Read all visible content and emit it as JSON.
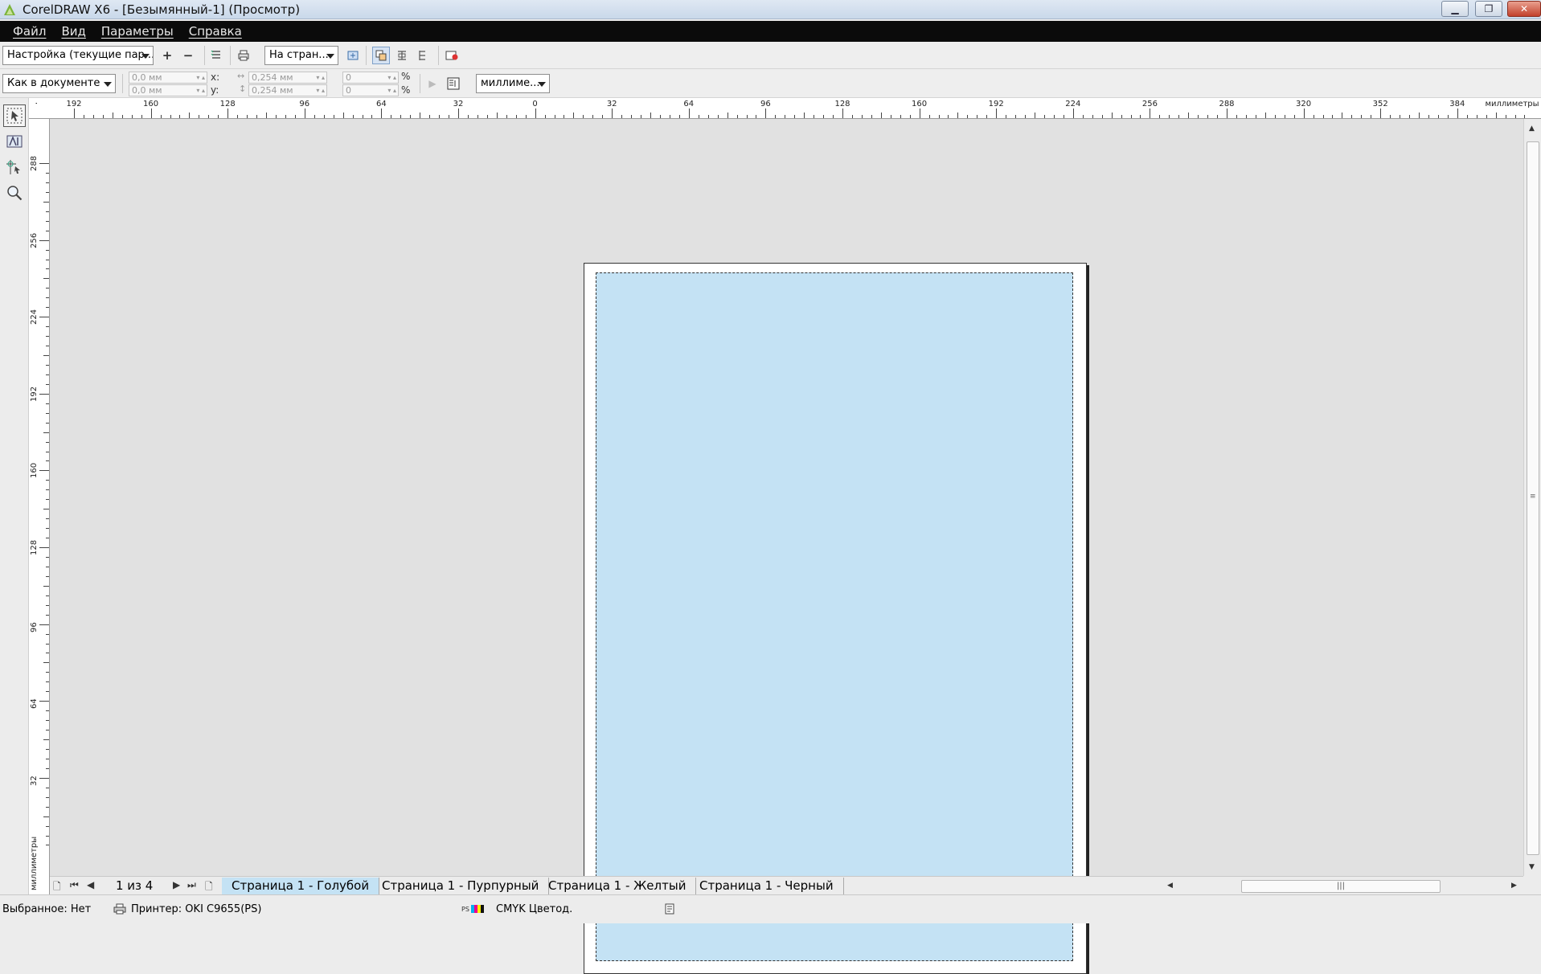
{
  "window": {
    "title": "CorelDRAW X6 - [Безымянный-1] (Просмотр)",
    "min_glyph": "▁",
    "max_glyph": "❐",
    "close_glyph": "✕"
  },
  "menu": {
    "items": [
      {
        "label": "Файл"
      },
      {
        "label": "Вид"
      },
      {
        "label": "Параметры"
      },
      {
        "label": "Справка"
      }
    ]
  },
  "toolbar1": {
    "preset_combo": "Настройка (текущие пар...",
    "add_glyph": "+",
    "remove_glyph": "−",
    "page_fit_combo": "На стран..."
  },
  "toolbar2": {
    "position_combo": "Как в документе",
    "x_value": "0,0 мм",
    "y_value": "0,0 мм",
    "x_label": "x:",
    "y_label": "y:",
    "width_value": "0,254 мм",
    "height_value": "0,254 мм",
    "scale_x": "0",
    "scale_y": "0",
    "percent": "%",
    "units_combo": "миллиме..."
  },
  "ruler": {
    "units_label": "миллиметры",
    "h_labels": [
      "192",
      "160",
      "128",
      "96",
      "64",
      "32",
      "0",
      "32",
      "64",
      "96",
      "128",
      "160",
      "192",
      "224",
      "256",
      "288",
      "320",
      "352",
      "384"
    ],
    "v_labels": [
      "288",
      "256",
      "224",
      "192",
      "160",
      "128",
      "96",
      "64",
      "32"
    ]
  },
  "pagebar": {
    "page_counter": "1 из 4",
    "tabs": [
      {
        "label": "Страница 1 - Голубой"
      },
      {
        "label": "Страница 1 - Пурпурный"
      },
      {
        "label": "Страница 1 - Желтый"
      },
      {
        "label": "Страница 1 - Черный"
      }
    ]
  },
  "status": {
    "selected": "Выбранное: Нет",
    "printer": "Принтер: OKI C9655(PS)",
    "color_mode": "CMYK Цветод."
  },
  "colors": {
    "cyan_plate": "#c4e2f4",
    "menubar": "#0b0b0b"
  }
}
